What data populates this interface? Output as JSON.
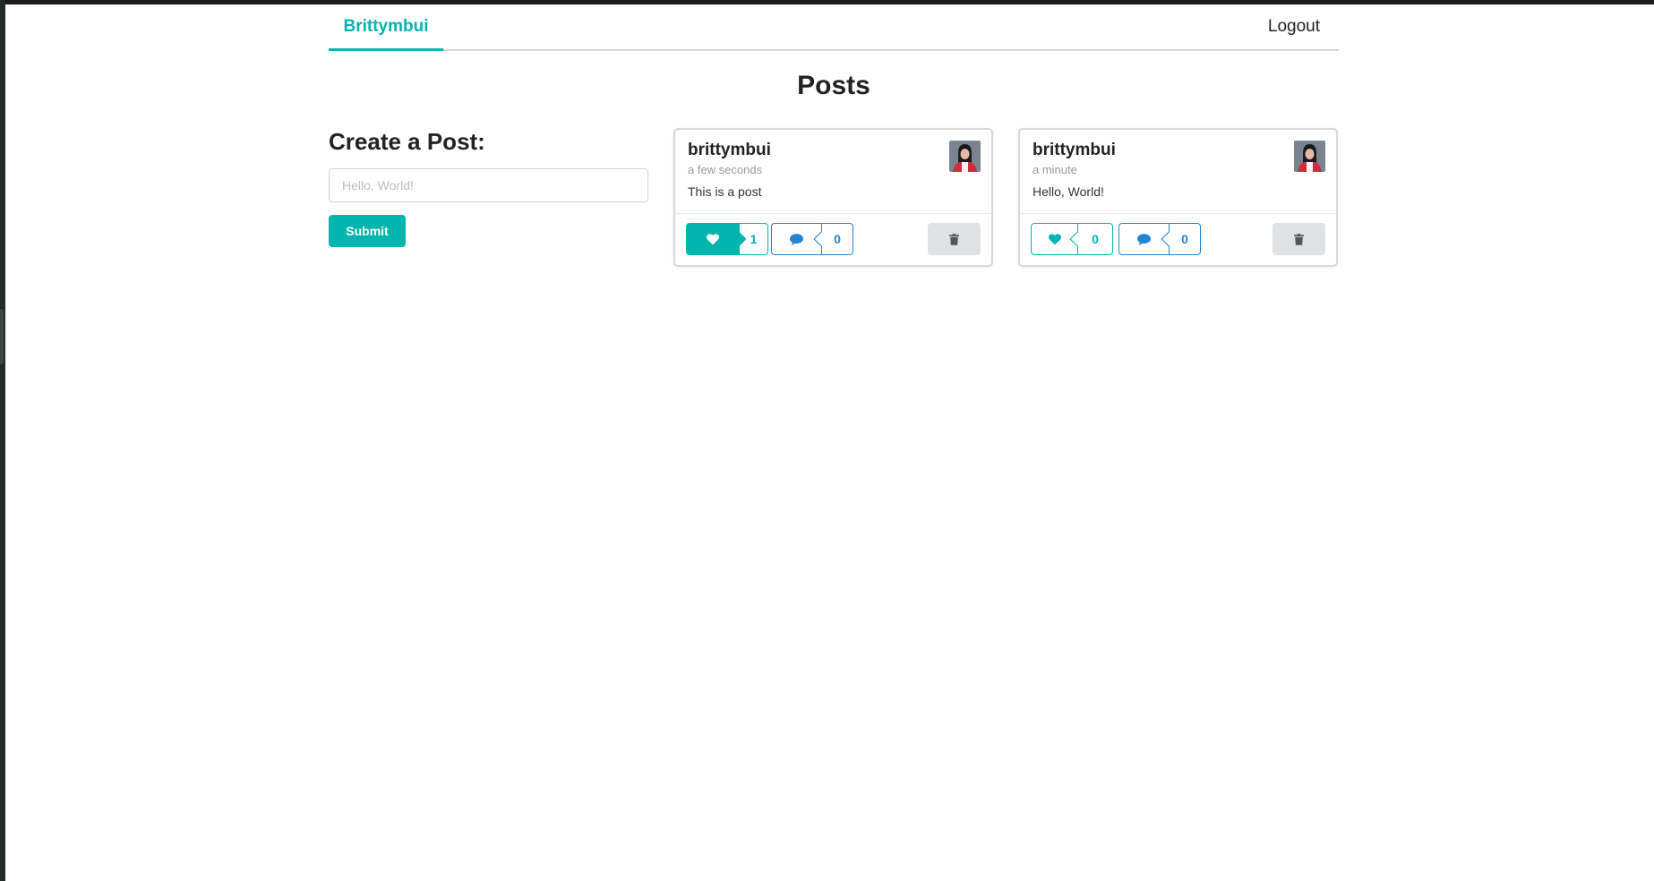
{
  "menu": {
    "brand": "Brittymbui",
    "logout": "Logout"
  },
  "page_title": "Posts",
  "create": {
    "title": "Create a Post:",
    "placeholder": "Hello, World!",
    "submit": "Submit"
  },
  "colors": {
    "accent": "#00b5ad",
    "comment": "#2185d0",
    "delete_bg": "#e0e1e2"
  },
  "posts": [
    {
      "author": "brittymbui",
      "time": "a few seconds",
      "body": "This is a post",
      "likes": "1",
      "liked": true,
      "comments": "0"
    },
    {
      "author": "brittymbui",
      "time": "a minute",
      "body": "Hello, World!",
      "likes": "0",
      "liked": false,
      "comments": "0"
    }
  ]
}
